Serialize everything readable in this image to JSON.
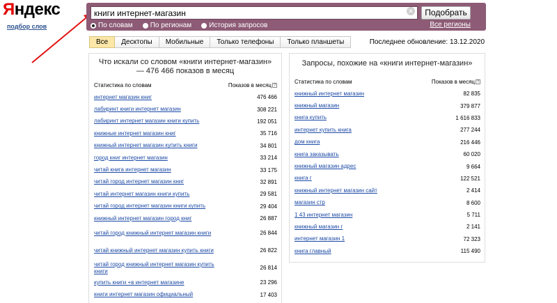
{
  "logo": {
    "first": "Я",
    "rest": "ндекс",
    "subtitle": "подбор слов"
  },
  "search": {
    "query": "книги интернет-магазин",
    "submit_label": "Подобрать",
    "clear_icon": "close-icon",
    "modes": [
      {
        "label": "По словам",
        "selected": true
      },
      {
        "label": "По регионам",
        "selected": false
      },
      {
        "label": "История запросов",
        "selected": false
      }
    ],
    "regions_link": "Все регионы"
  },
  "tabs": [
    {
      "label": "Все",
      "active": true
    },
    {
      "label": "Десктопы",
      "active": false
    },
    {
      "label": "Мобильные",
      "active": false
    },
    {
      "label": "Только телефоны",
      "active": false
    },
    {
      "label": "Только планшеты",
      "active": false
    }
  ],
  "updated": "Последнее обновление: 13.12.2020",
  "left_panel": {
    "title": "Что искали со словом «книги интернет-магазин» — 476 466 показов в месяц",
    "col_keyword": "Статистика по словам",
    "col_count": "Показов в месяц",
    "rows": [
      {
        "kw": "интернет магазин книг",
        "cnt": "476 466"
      },
      {
        "kw": "лабиринт книги интернет магазин",
        "cnt": "308 221"
      },
      {
        "kw": "лабиринт интернет магазин книги купить",
        "cnt": "192 051"
      },
      {
        "kw": "книжные интернет магазин книг",
        "cnt": "35 716"
      },
      {
        "kw": "книжный интернет магазин купить книги",
        "cnt": "34 801"
      },
      {
        "kw": "город книг интернет магазин",
        "cnt": "33 214"
      },
      {
        "kw": "читай книга интернет магазин",
        "cnt": "33 175"
      },
      {
        "kw": "читай город интернет магазин книг",
        "cnt": "32 891"
      },
      {
        "kw": "читай интернет магазин книги купить",
        "cnt": "29 581"
      },
      {
        "kw": "читай город интернет магазин книги купить",
        "cnt": "29 404"
      },
      {
        "kw": "книжный интернет магазин город книг",
        "cnt": "26 887"
      },
      {
        "kw": "читай город книжный интернет магазин книги",
        "cnt": "26 844",
        "tall": true
      },
      {
        "kw": "читай книжный интернет магазин купить книги",
        "cnt": "26 822",
        "tall": true
      },
      {
        "kw": "читай город книжный интернет магазин купить книги",
        "cnt": "26 814",
        "tall": true
      },
      {
        "kw": "купить книги +в интернет магазине",
        "cnt": "23 296"
      },
      {
        "kw": "книги интернет магазин официальный",
        "cnt": "17 403"
      }
    ]
  },
  "right_panel": {
    "title": "Запросы, похожие на «книги интернет-магазин»",
    "col_keyword": "Статистика по словам",
    "col_count": "Показов в месяц",
    "rows": [
      {
        "kw": "книжный интернет магазин",
        "cnt": "82 835"
      },
      {
        "kw": "книжный магазин",
        "cnt": "379 877"
      },
      {
        "kw": "книга купить",
        "cnt": "1 616 833"
      },
      {
        "kw": "интернет купить книга",
        "cnt": "277 244"
      },
      {
        "kw": "дом книга",
        "cnt": "216 446"
      },
      {
        "kw": "книга заказывать",
        "cnt": "60 020"
      },
      {
        "kw": "книжный магазин адрес",
        "cnt": "9 664"
      },
      {
        "kw": "книга г",
        "cnt": "122 521"
      },
      {
        "kw": "книжный интернет магазин сайт",
        "cnt": "2 414"
      },
      {
        "kw": "магазин стр",
        "cnt": "8 600"
      },
      {
        "kw": "1 43 интернет магазин",
        "cnt": "5 711"
      },
      {
        "kw": "книжный магазин г",
        "cnt": "2 141"
      },
      {
        "kw": "интернет магазин 1",
        "cnt": "72 323"
      },
      {
        "kw": "книга главный",
        "cnt": "115 490"
      }
    ]
  },
  "colors": {
    "header_bar": "#8d5b76",
    "link": "#1c4aa6",
    "arrow": "#e01010",
    "active_tab": "#fce7a8"
  }
}
